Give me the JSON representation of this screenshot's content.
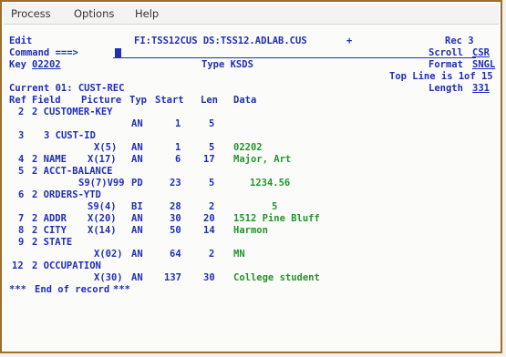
{
  "menu": {
    "process": "Process",
    "options": "Options",
    "help": "Help"
  },
  "header": {
    "edit": "Edit",
    "file_info": "FI:TSS12CUS DS:TSS12.ADLAB.CUS",
    "plus": "+",
    "rec": "Rec 3",
    "command_label": "Command ===>",
    "scroll_label": "Scroll",
    "scroll_value": "CSR",
    "key_label": "Key",
    "key_value": "02202",
    "type_label": "Type KSDS",
    "format_label": "Format",
    "format_value": "SNGL",
    "top_line": "Top Line is 1",
    "of_count": "of 15",
    "current": "Current 01: CUST-REC",
    "length_label": "Length",
    "length_value": "331"
  },
  "columns": {
    "ref": "Ref",
    "field": "Field",
    "picture": "Picture",
    "type": "Typ",
    "start": "Start",
    "len": "Len",
    "data": "Data"
  },
  "rows": [
    {
      "ref": "2",
      "field": "2 CUSTOMER-KEY"
    },
    {
      "picture": "",
      "type": "AN",
      "start": "1",
      "len": "5",
      "data": ""
    },
    {
      "ref": "3",
      "field": "3 CUST-ID"
    },
    {
      "picture": "X(5)",
      "type": "AN",
      "start": "1",
      "len": "5",
      "data": "02202"
    },
    {
      "ref": "4",
      "field": "2 NAME",
      "picture": "X(17)",
      "type": "AN",
      "start": "6",
      "len": "17",
      "data": "Major, Art"
    },
    {
      "ref": "5",
      "field": "2 ACCT-BALANCE"
    },
    {
      "picture": "S9(7)V99",
      "type": "PD",
      "start": "23",
      "len": "5",
      "data": "1234.56"
    },
    {
      "ref": "6",
      "field": "2 ORDERS-YTD"
    },
    {
      "picture": "S9(4)",
      "type": "BI",
      "start": "28",
      "len": "2",
      "data": "5"
    },
    {
      "ref": "7",
      "field": "2 ADDR",
      "picture": "X(20)",
      "type": "AN",
      "start": "30",
      "len": "20",
      "data": "1512 Pine Bluff"
    },
    {
      "ref": "8",
      "field": "2 CITY",
      "picture": "X(14)",
      "type": "AN",
      "start": "50",
      "len": "14",
      "data": "Harmon"
    },
    {
      "ref": "9",
      "field": "2 STATE"
    },
    {
      "picture": "X(02)",
      "type": "AN",
      "start": "64",
      "len": "2",
      "data": "MN"
    },
    {
      "ref": "12",
      "field": "2 OCCUPATION"
    },
    {
      "picture": "X(30)",
      "type": "AN",
      "start": "137",
      "len": "30",
      "data": "College student"
    }
  ],
  "footer": {
    "stars_left": "***",
    "end_text": "End of record",
    "stars_right": "***"
  }
}
